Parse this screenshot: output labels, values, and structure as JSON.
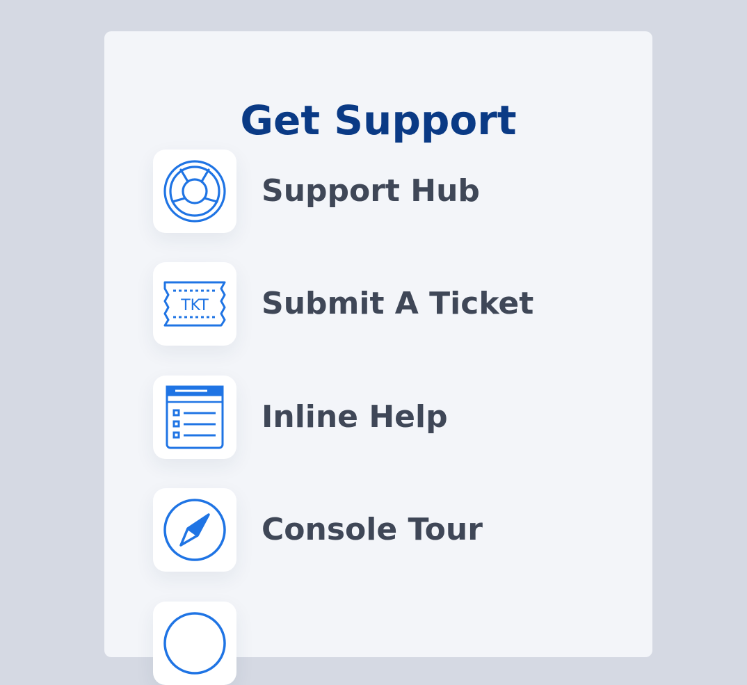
{
  "page": {
    "title": "Get Support"
  },
  "colors": {
    "title": "#0a3a85",
    "icon": "#1f74e4",
    "label": "#3f4757",
    "panel": "#f3f5f9",
    "backdrop": "#d5d9e3"
  },
  "menu": {
    "items": [
      {
        "label": "Support Hub",
        "icon": "lifebuoy-icon"
      },
      {
        "label": "Submit A Ticket",
        "icon": "ticket-icon",
        "icon_text": "TKT"
      },
      {
        "label": "Inline Help",
        "icon": "help-window-icon"
      },
      {
        "label": "Console Tour",
        "icon": "compass-icon"
      },
      {
        "label": "",
        "icon": "circle-icon"
      }
    ]
  }
}
